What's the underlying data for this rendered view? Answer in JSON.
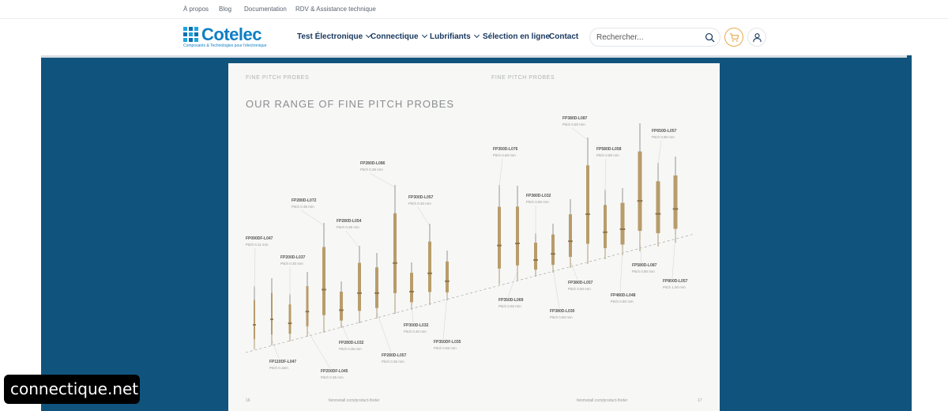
{
  "topbar": {
    "links": [
      "À propos",
      "Blog",
      "Documentation",
      "RDV & Assistance technique"
    ]
  },
  "logo": {
    "word": "Cotelec",
    "tagline": "Composants & Technologies pour l'électronique"
  },
  "nav": [
    {
      "label": "Test Électronique",
      "dropdown": true
    },
    {
      "label": "Connectique",
      "dropdown": true
    },
    {
      "label": "Lubrifiants",
      "dropdown": true
    },
    {
      "label": "Sélection en ligne",
      "dropdown": false
    },
    {
      "label": "Contact",
      "dropdown": false
    }
  ],
  "search": {
    "placeholder": "Rechercher..."
  },
  "icons": {
    "search": "search-icon",
    "cart": "cart-icon",
    "user": "user-icon"
  },
  "colors": {
    "brand": "#0e7fc4",
    "nav": "#17375e",
    "background": "#10547d",
    "cart_accent": "#e8a84a",
    "probe": "#b89c6a"
  },
  "document": {
    "header_left": "FINE PITCH PROBES",
    "header_right": "FINE PITCH PROBES",
    "title": "OUR RANGE OF FINE PITCH PROBES",
    "footer_left_page": "16",
    "footer_left_url": "feinmetall.com/product-finder",
    "footer_right_url": "feinmetall.com/product-finder",
    "footer_right_page": "17",
    "probes": [
      {
        "name": "FP090DF-L047",
        "pitch": "Pitch 0.11 mm"
      },
      {
        "name": "FP110DF-L047",
        "pitch": "Pitch 0.15m"
      },
      {
        "name": "FP200D-L037",
        "pitch": "Pitch 0.30 mm"
      },
      {
        "name": "FP200DF-L045",
        "pitch": "Pitch 0.35 mm"
      },
      {
        "name": "FP280D-L072",
        "pitch": "Pitch 0.35 mm"
      },
      {
        "name": "FP280D-L032",
        "pitch": "Pitch 0.35 mm"
      },
      {
        "name": "FP280D-L054",
        "pitch": "Pitch 0.35 mm"
      },
      {
        "name": "FP280D-L057",
        "pitch": "Pitch 0.35 mm"
      },
      {
        "name": "FP280D-L086",
        "pitch": "Pitch 0.35 mm"
      },
      {
        "name": "FP300D-L032",
        "pitch": "Pitch 0.40 mm"
      },
      {
        "name": "FP300D-L057",
        "pitch": "Pitch 0.40 mm"
      },
      {
        "name": "FP350DF-L035",
        "pitch": "Pitch 0.55 mm"
      },
      {
        "name": "FP350D-L076",
        "pitch": "Pitch 0.50 mm"
      },
      {
        "name": "FP350D-L069",
        "pitch": "Pitch 0.50 mm"
      },
      {
        "name": "FP380D-L032",
        "pitch": "Pitch 0.50 mm"
      },
      {
        "name": "FP380D-L030",
        "pitch": "Pitch 0.50 mm"
      },
      {
        "name": "FP380D-L057",
        "pitch": "Pitch 0.50 mm"
      },
      {
        "name": "FP380D-L087",
        "pitch": "Pitch 0.50 mm"
      },
      {
        "name": "FP580D-L058",
        "pitch": "Pitch 0.80 mm"
      },
      {
        "name": "FP480D-L048",
        "pitch": "Pitch 0.80 mm"
      },
      {
        "name": "FP580D-L087",
        "pitch": "Pitch 0.80 mm"
      },
      {
        "name": "FP650D-L057",
        "pitch": "Pitch 0.80 mm"
      },
      {
        "name": "FP800D-L057",
        "pitch": "Pitch 1.00 mm"
      }
    ]
  },
  "watermark": "connectique.net"
}
